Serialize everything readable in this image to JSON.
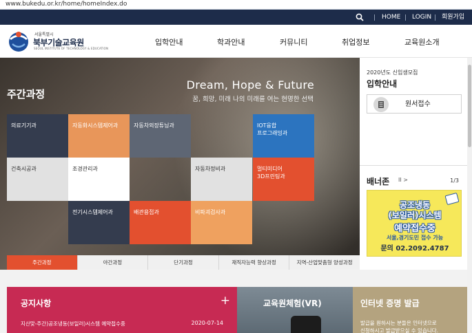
{
  "browser": {
    "url": "www.bukedu.or.kr/home/homeIndex.do"
  },
  "topbar": {
    "home": "HOME",
    "login": "LOGIN",
    "join": "회원가입"
  },
  "logo": {
    "small": "서울특별시",
    "main": "북부기술교육원",
    "eng": "SEOUL INSTITUTE OF TECHNOLOGY & EDUCATION"
  },
  "nav": [
    "입학안내",
    "학과안내",
    "커뮤니티",
    "취업정보",
    "교육원소개"
  ],
  "hero": {
    "title": "주간과정",
    "slogan": "Dream, Hope & Future",
    "sub": "꿈, 희망, 미래 나의 미래를 여는 현명한 선택",
    "tiles": [
      "의료기기과",
      "자동화시스템제어과",
      "자동차외장튜닝과",
      "IOT융합\n프로그래밍과",
      "건축시공과",
      "조경관리과",
      "자동차정비과",
      "멀티미디어\n3D프린팅과",
      "전기시스템제어과",
      "배관용접과",
      "비파괴검사과"
    ],
    "tabs": [
      "주간과정",
      "야간과정",
      "단기과정",
      "재직자능력 향상과정",
      "지역-산업맞춤형 양성과정"
    ]
  },
  "admission": {
    "small": "2020년도 신입생모집",
    "title": "입학안내",
    "apply": "원서접수"
  },
  "bannerzone": {
    "title": "배너존",
    "controls": "II >",
    "page": "1/3",
    "lines": [
      "공조냉동",
      "(보일러)시스템",
      "예약접수중",
      "서울,경기도민 접수 가능",
      "문의 02.2092.4787"
    ]
  },
  "notice": {
    "title": "공지사항",
    "more": "+",
    "item": "지산맞-주간)공조냉동(보일러)시스템 예약접수중",
    "date": "2020-07-14"
  },
  "vr": {
    "title": "교육원체험(VR)"
  },
  "cert": {
    "title": "인터넷 증명 발급",
    "desc1": "발급을 원하시는 분들은 인터넷으로",
    "desc2": "신청하시고 발급받으실 수 있습니다."
  }
}
